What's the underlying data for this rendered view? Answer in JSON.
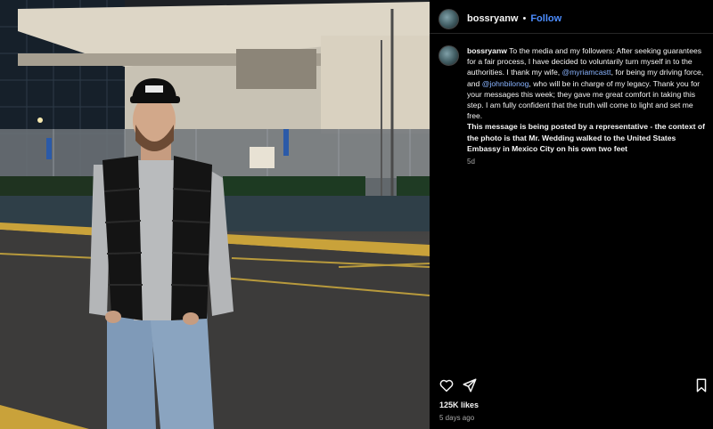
{
  "post": {
    "username": "bossryanw",
    "separator": "•",
    "follow_label": "Follow",
    "caption": {
      "username": "bossryanw",
      "text_1": " To the media and my followers: After seeking guarantees for a fair process, I have decided to voluntarily turn myself in to the authorities. I thank my wife, ",
      "mention_1": "@myriamcastt",
      "text_2": ", for being my driving force, and ",
      "mention_2": "@johnbilonog",
      "text_3": ", who will be in charge of my legacy. Thank you for your messages this week; they gave me great comfort in taking this step. I am fully confident that the truth will come to light and set me free.",
      "note": "This message is being posted by a representative - the context of the photo is that Mr. Wedding walked to the United States Embassy in Mexico City on his own two feet",
      "time": "5d"
    },
    "likes": "125K likes",
    "posted": "5 days ago",
    "icons": [
      "heart-icon",
      "share-icon",
      "bookmark-icon"
    ],
    "colors": {
      "link": "#4c8dff",
      "mention": "#8ab4ff",
      "background": "#000000",
      "muted": "#a8a8a8"
    }
  }
}
